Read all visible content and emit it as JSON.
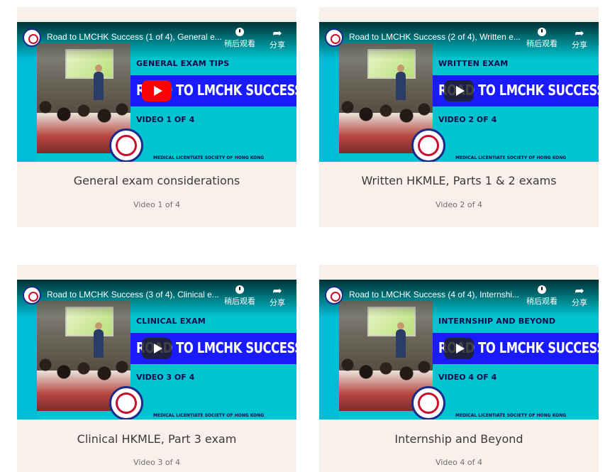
{
  "videos": [
    {
      "title": "Road to LMCHK Success (1 of 4), General e...",
      "section": "GENERAL EXAM TIPS",
      "road": "ROAD TO LMCHK SUCCESS",
      "video_num": "VIDEO 1 OF 4",
      "caption": "General exam considerations",
      "sub": "Video 1 of 4",
      "play_style": "red"
    },
    {
      "title": "Road to LMCHK Success (2 of 4), Written e...",
      "section": "WRITTEN EXAM",
      "road": "ROAD TO LMCHK SUCCESS",
      "video_num": "VIDEO 2 OF 4",
      "caption": "Written HKMLE, Parts 1 & 2 exams",
      "sub": "Video 2 of 4",
      "play_style": "dark"
    },
    {
      "title": "Road to LMCHK Success (3 of 4), Clinical e...",
      "section": "CLINICAL EXAM",
      "road": "ROAD TO LMCHK SUCCESS",
      "video_num": "VIDEO 3 OF 4",
      "caption": "Clinical HKMLE, Part 3 exam",
      "sub": "Video 3 of 4",
      "play_style": "dark"
    },
    {
      "title": "Road to LMCHK Success (4 of 4), Internshi...",
      "section": "INTERNSHIP AND BEYOND",
      "road": "ROAD TO LMCHK SUCCESS",
      "video_num": "VIDEO 4 OF 4",
      "caption": "Internship and Beyond",
      "sub": "Video 4 of 4",
      "play_style": "dark"
    }
  ],
  "player": {
    "watch_later_label": "稍后观看",
    "share_label": "分享"
  },
  "society_text": "MEDICAL LICENTIATE SOCIETY OF HONG KONG",
  "colors": {
    "card_bg": "#faf0eb",
    "thumb_cyan": "#00c4cf",
    "thumb_blue": "#1a1aff",
    "play_red": "#ff0000"
  }
}
